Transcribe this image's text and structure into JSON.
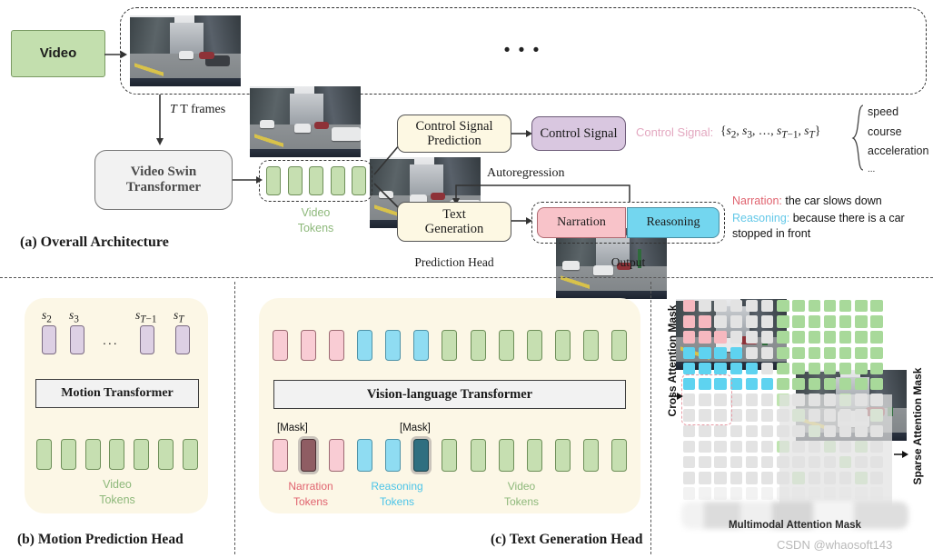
{
  "figure": {
    "panel_a": {
      "caption": "(a) Overall Architecture",
      "video_label": "Video",
      "frames_label": "T frames",
      "backbone": "Video Swin\nTransformer",
      "backbone_line1": "Video Swin",
      "backbone_line2": "Transformer",
      "video_tokens_label_line1": "Video",
      "video_tokens_label_line2": "Tokens",
      "control_pred_line1": "Control Signal",
      "control_pred_line2": "Prediction",
      "control_signal_box": "Control Signal",
      "text_gen_line1": "Text",
      "text_gen_line2": "Generation",
      "autoregression_label": "Autoregression",
      "prediction_head_label": "Prediction Head",
      "output_label": "Output",
      "narration_box": "Narration",
      "reasoning_box": "Reasoning",
      "control_signal_formula_prefix": "Control Signal:",
      "control_signal_formula": "{s2, s3, …, sT−1, sT}",
      "signal_items": [
        "speed",
        "course",
        "acceleration",
        "..."
      ],
      "narration_key": "Narration:",
      "narration_text": "the car slows down",
      "reasoning_key": "Reasoning:",
      "reasoning_text_line1": "because there is a car",
      "reasoning_text_line2": "stopped in front",
      "frame_ellipsis": "• • •",
      "num_video_tokens": 5
    },
    "panel_b": {
      "caption": "(b) Motion Prediction Head",
      "transformer_label": "Motion Transformer",
      "state_labels": [
        "s2",
        "s3",
        "sT−1",
        "sT"
      ],
      "state_subscripts": [
        "2",
        "3",
        "T−1",
        "T"
      ],
      "ellipsis": "...",
      "video_tokens_label_line1": "Video",
      "video_tokens_label_line2": "Tokens",
      "num_state_tokens": 4,
      "num_video_tokens": 7
    },
    "panel_c": {
      "caption": "(c) Text Generation Head",
      "transformer_label": "Vision-language Transformer",
      "mask_label": "[Mask]",
      "narration_label_line1": "Narration",
      "narration_label_line2": "Tokens",
      "reasoning_label_line1": "Reasoning",
      "reasoning_label_line2": "Tokens",
      "video_label_line1": "Video",
      "video_label_line2": "Tokens",
      "top_row_tokens": [
        "pink",
        "pink",
        "pink",
        "blue",
        "blue",
        "blue",
        "green",
        "green",
        "green",
        "green",
        "green",
        "green",
        "green"
      ],
      "bottom_row_tokens": [
        "pink",
        "darkpink",
        "pink",
        "blue",
        "blue",
        "darkblue",
        "green",
        "green",
        "green",
        "green",
        "green",
        "green",
        "green"
      ]
    },
    "panel_d": {
      "cross_attention_label": "Cross Attention Mask",
      "sparse_attention_label": "Sparse Attention Mask",
      "multimodal_attention_label": "Multimodal Attention Mask",
      "grid_cols": 13,
      "grid_rows": 13,
      "grid": [
        [
          "pink",
          "grey",
          "grey",
          "grey",
          "grey",
          "grey",
          "green",
          "green",
          "green",
          "green",
          "green",
          "green",
          "green"
        ],
        [
          "pink",
          "pink",
          "grey",
          "grey",
          "grey",
          "grey",
          "green",
          "green",
          "green",
          "green",
          "green",
          "green",
          "green"
        ],
        [
          "pink",
          "pink",
          "pink",
          "grey",
          "grey",
          "grey",
          "green",
          "green",
          "green",
          "green",
          "green",
          "green",
          "green"
        ],
        [
          "blue",
          "blue",
          "blue",
          "blue",
          "grey",
          "grey",
          "green",
          "green",
          "green",
          "green",
          "green",
          "green",
          "green"
        ],
        [
          "blue",
          "blue",
          "blue",
          "blue",
          "blue",
          "grey",
          "green",
          "green",
          "green",
          "green",
          "green",
          "green",
          "green"
        ],
        [
          "blue",
          "blue",
          "blue",
          "blue",
          "blue",
          "blue",
          "green",
          "green",
          "green",
          "green",
          "green",
          "green",
          "green"
        ],
        [
          "grey",
          "grey",
          "grey",
          "grey",
          "grey",
          "grey",
          "greenL",
          "grey",
          "grey",
          "grey",
          "greenL",
          "grey",
          "grey"
        ],
        [
          "grey",
          "grey",
          "grey",
          "grey",
          "grey",
          "grey",
          "grey",
          "greenL",
          "grey",
          "grey",
          "grey",
          "grey",
          "greenL"
        ],
        [
          "grey",
          "grey",
          "grey",
          "grey",
          "grey",
          "grey",
          "grey",
          "grey",
          "greenL",
          "grey",
          "grey",
          "grey",
          "grey"
        ],
        [
          "grey",
          "grey",
          "grey",
          "grey",
          "grey",
          "grey",
          "greenL",
          "grey",
          "grey",
          "greenL",
          "grey",
          "greenL",
          "grey"
        ],
        [
          "grey",
          "grey",
          "grey",
          "grey",
          "grey",
          "grey",
          "grey",
          "grey",
          "grey",
          "grey",
          "greenL",
          "grey",
          "grey"
        ],
        [
          "grey",
          "grey",
          "grey",
          "grey",
          "grey",
          "grey",
          "grey",
          "greenL",
          "grey",
          "grey",
          "grey",
          "greenL",
          "grey"
        ],
        [
          "grey",
          "grey",
          "grey",
          "grey",
          "grey",
          "grey",
          "grey",
          "grey",
          "grey",
          "grey",
          "grey",
          "grey",
          "grey"
        ]
      ]
    },
    "watermark": "CSDN @whaosoft143"
  },
  "colors": {
    "green": "#c6dfb1",
    "pink": "#f9ccd4",
    "blue": "#8fdcf2",
    "purple": "#d9c7e0",
    "cream": "#fcf7e6",
    "narration_text": "#e0636f",
    "reasoning_text": "#63c8e8",
    "control_signal_text": "#e3a8c0",
    "token_label_green": "#8db87a"
  }
}
